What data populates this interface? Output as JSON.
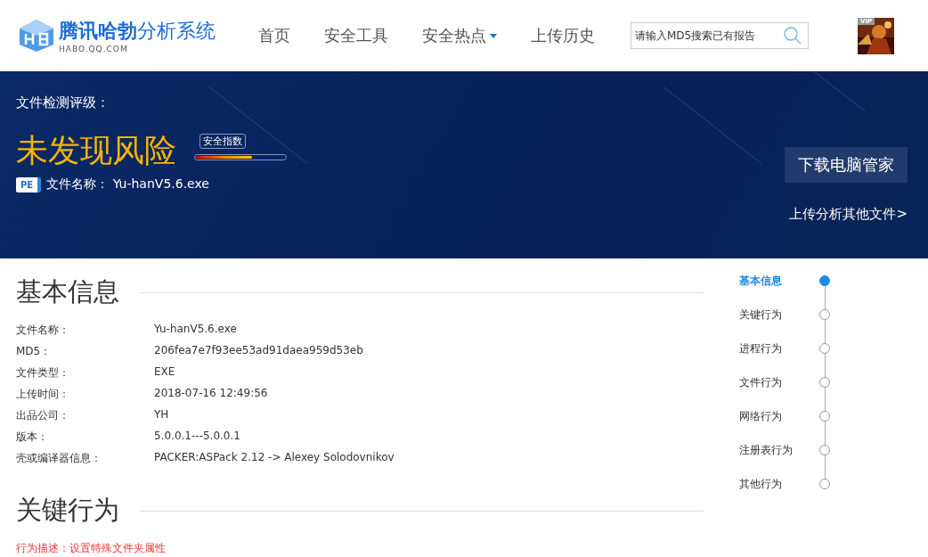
{
  "header": {
    "logo_name": "腾讯哈勃",
    "logo_suffix": "分析系统",
    "logo_domain": "HABO.QQ.COM",
    "nav": [
      {
        "label": "首页",
        "dropdown": false
      },
      {
        "label": "安全工具",
        "dropdown": false
      },
      {
        "label": "安全热点",
        "dropdown": true
      },
      {
        "label": "上传历史",
        "dropdown": false
      }
    ],
    "search": {
      "placeholder": "请输入MD5搜索已有报告"
    },
    "avatar": {
      "badge": "VIP"
    }
  },
  "banner": {
    "rating_label": "文件检测评级：",
    "verdict": "未发现风险",
    "meter": {
      "label": "安全指数",
      "level": 0.63
    },
    "file_icon": "PE",
    "file_label": "文件名称：",
    "file_name": "Yu-hanV5.6.exe",
    "download_button": "下载电脑管家",
    "upload_link": "上传分析其他文件>"
  },
  "basic_info": {
    "title": "基本信息",
    "rows": [
      {
        "label": "文件名称：",
        "value": "Yu-hanV5.6.exe"
      },
      {
        "label": "MD5：",
        "value": "206fea7e7f93ee53ad91daea959d53eb"
      },
      {
        "label": "文件类型：",
        "value": "EXE"
      },
      {
        "label": "上传时间：",
        "value": "2018-07-16 12:49:56"
      },
      {
        "label": "出品公司：",
        "value": "YH"
      },
      {
        "label": "版本：",
        "value": "5.0.0.1---5.0.0.1"
      },
      {
        "label": "壳或编译器信息：",
        "value": "PACKER:ASPack 2.12 -> Alexey Solodovnikov"
      }
    ]
  },
  "key_behavior": {
    "title": "关键行为",
    "description": "行为描述：设置特殊文件夹属性"
  },
  "side_nav": [
    {
      "label": "基本信息",
      "selected": true
    },
    {
      "label": "关键行为",
      "selected": false
    },
    {
      "label": "进程行为",
      "selected": false
    },
    {
      "label": "文件行为",
      "selected": false
    },
    {
      "label": "网络行为",
      "selected": false
    },
    {
      "label": "注册表行为",
      "selected": false
    },
    {
      "label": "其他行为",
      "selected": false
    }
  ]
}
